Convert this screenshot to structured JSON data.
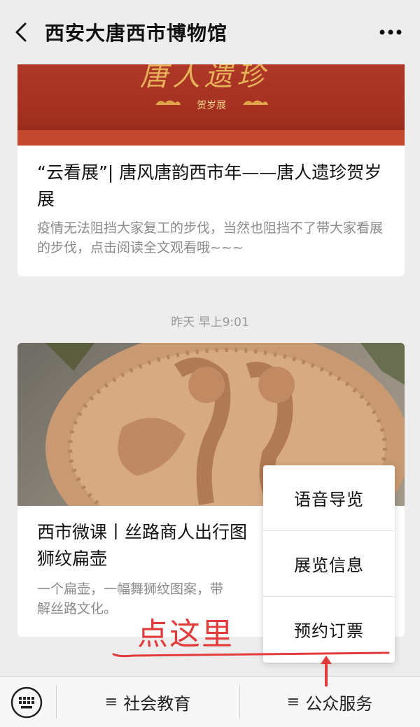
{
  "header": {
    "title": "西安大唐西市博物馆",
    "back_icon": "chevron-left-icon",
    "more_icon": "more-horizontal-icon"
  },
  "articles": [
    {
      "banner_text": "唐人遗珍",
      "banner_sub": "贺岁展",
      "title": "“云看展”| 唐风唐韵西市年——唐人遗珍贺岁展",
      "desc": "疫情无法阻挡大家复工的步伐，当然也阻挡不了带大家看展的步伐，点击阅读全文观看哦~~~"
    },
    {
      "timestamp": "昨天 早上9:01",
      "title": "西市微课丨丝路商人出行图",
      "title_line2": "狮纹扁壶",
      "desc": "一个扁壶，一幅舞狮纹图案，带",
      "desc_line2": "解丝路文化。"
    }
  ],
  "popup_menu": {
    "items": [
      "语音导览",
      "展览信息",
      "预约订票"
    ]
  },
  "annotation": {
    "text": "点这里",
    "color": "#e23b3b"
  },
  "bottom_bar": {
    "keyboard_icon": "keyboard-icon",
    "menu_icon": "menu-lines-icon",
    "tabs": [
      "社会教育",
      "公众服务"
    ]
  }
}
